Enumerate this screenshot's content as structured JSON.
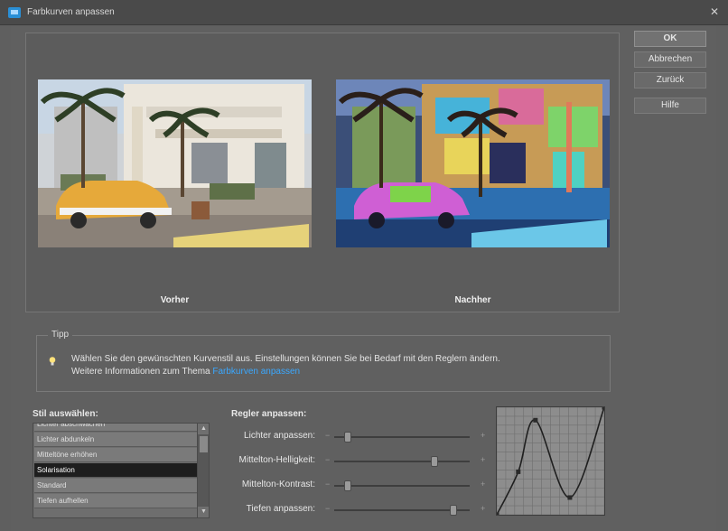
{
  "window": {
    "title": "Farbkurven anpassen"
  },
  "buttons": {
    "ok": "OK",
    "cancel": "Abbrechen",
    "reset": "Zurück",
    "help": "Hilfe"
  },
  "preview": {
    "before_label": "Vorher",
    "after_label": "Nachher"
  },
  "tip": {
    "legend": "Tipp",
    "line1": "Wählen Sie den gewünschten Kurvenstil aus. Einstellungen können Sie bei Bedarf mit den Reglern ändern.",
    "line2_prefix": "Weitere Informationen zum Thema",
    "link": "Farbkurven anpassen"
  },
  "style_list": {
    "label": "Stil auswählen:",
    "items": [
      {
        "label": "Lichter abschwächen",
        "selected": false
      },
      {
        "label": "Lichter abdunkeln",
        "selected": false
      },
      {
        "label": "Mitteltöne erhöhen",
        "selected": false
      },
      {
        "label": "Solarisation",
        "selected": true
      },
      {
        "label": "Standard",
        "selected": false
      },
      {
        "label": "Tiefen aufhellen",
        "selected": false
      }
    ]
  },
  "sliders": {
    "label": "Regler anpassen:",
    "items": [
      {
        "label": "Lichter anpassen:",
        "value": 0.1
      },
      {
        "label": "Mittelton-Helligkeit:",
        "value": 0.74
      },
      {
        "label": "Mittelton-Kontrast:",
        "value": 0.1
      },
      {
        "label": "Tiefen anpassen:",
        "value": 0.88
      }
    ]
  },
  "curve": {
    "points": [
      [
        0,
        0
      ],
      [
        0.2,
        0.4
      ],
      [
        0.36,
        0.88
      ],
      [
        0.68,
        0.16
      ],
      [
        1,
        1
      ]
    ]
  },
  "colors": {
    "accent": "#3aa8ff",
    "selected_row": "#1e1e1e"
  }
}
